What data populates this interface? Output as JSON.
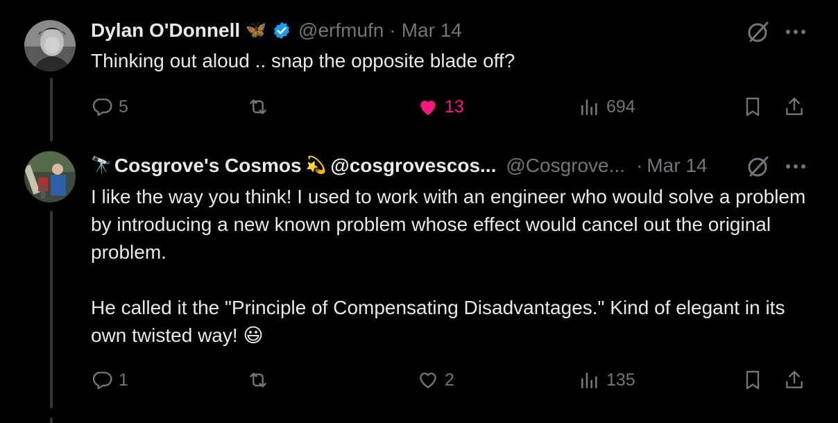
{
  "tweets": [
    {
      "display_name": "Dylan O'Donnell",
      "name_emoji": "🦋",
      "verified": true,
      "handle": "@erfmufn",
      "separator": "·",
      "date": "Mar 14",
      "text_lines": [
        "Thinking out aloud .. snap the opposite blade off?"
      ],
      "replies": "5",
      "reposts": "",
      "likes": "13",
      "liked": true,
      "views": "694"
    },
    {
      "name_prefix_emoji": "🔭",
      "display_name": "Cosgrove's Cosmos",
      "name_emoji": "💫",
      "name_suffix": "@cosgrovescos...",
      "handle": "@Cosgrove...",
      "separator": "·",
      "date": "Mar 14",
      "paragraph1": "I like the way you think!  I used to work with an engineer who would solve a problem by introducing a new known problem whose effect would cancel out the original problem.",
      "paragraph2": "He called it the \"Principle of Compensating Disadvantages.\"  Kind of elegant in its own twisted way! 😃",
      "replies": "1",
      "reposts": "",
      "likes": "2",
      "liked": false,
      "views": "135"
    }
  ],
  "colors": {
    "background": "#000000",
    "text": "#e7e9ea",
    "muted": "#71767b",
    "like": "#f91880",
    "verified": "#1d9bf0",
    "thread_line": "#333639"
  },
  "icons": [
    "reply-icon",
    "repost-icon",
    "like-icon",
    "views-icon",
    "bookmark-icon",
    "share-icon",
    "grok-icon",
    "more-icon",
    "verified-badge-icon"
  ]
}
